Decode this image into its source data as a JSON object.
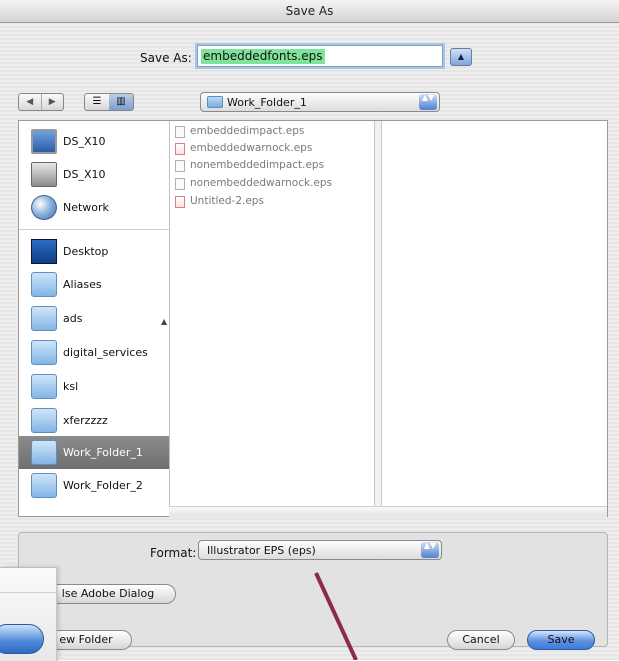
{
  "window": {
    "title": "Save As"
  },
  "save_as": {
    "label": "Save As:",
    "filename": "embeddedfonts.eps",
    "expand_glyph": "▲"
  },
  "toolbar": {
    "back": "◀",
    "forward": "▶",
    "list_view": "☰",
    "column_view": "▥"
  },
  "location": {
    "folder": "Work_Folder_1",
    "stepper": "▲▼"
  },
  "sidebar": {
    "items": [
      {
        "label": "DS_X10",
        "icon": "monitor-icon"
      },
      {
        "label": "DS_X10",
        "icon": "hard-disk-icon"
      },
      {
        "label": "Network",
        "icon": "network-globe-icon"
      },
      {
        "label": "Desktop",
        "icon": "desktop-icon"
      },
      {
        "label": "Aliases",
        "icon": "folder-icon"
      },
      {
        "label": "ads",
        "icon": "folder-icon"
      },
      {
        "label": "digital_services",
        "icon": "folder-icon"
      },
      {
        "label": "ksl",
        "icon": "folder-icon"
      },
      {
        "label": "xferzzzz",
        "icon": "folder-icon"
      },
      {
        "label": "Work_Folder_1",
        "icon": "folder-icon",
        "selected": true
      },
      {
        "label": "Work_Folder_2",
        "icon": "folder-icon"
      }
    ]
  },
  "files": [
    {
      "name": "embeddedimpact.eps",
      "type": "eps"
    },
    {
      "name": "embeddedwarnock.eps",
      "type": "pdf"
    },
    {
      "name": "nonembeddedimpact.eps",
      "type": "eps"
    },
    {
      "name": "nonembeddedwarnock.eps",
      "type": "eps"
    },
    {
      "name": "Untitled-2.eps",
      "type": "pdf"
    }
  ],
  "format": {
    "label": "Format:",
    "value": "Illustrator EPS (eps)"
  },
  "buttons": {
    "adobe_dialog": "lse Adobe Dialog",
    "new_folder": "ew Folder",
    "cancel": "Cancel",
    "save": "Save"
  },
  "colors": {
    "accent": "#3d79d6",
    "selection_highlight": "#7fe39a",
    "annotation_line": "#8b2a4f"
  }
}
